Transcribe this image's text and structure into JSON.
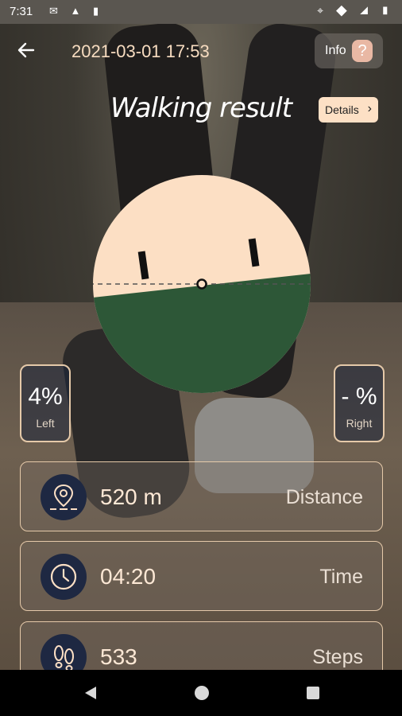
{
  "status_bar": {
    "time": "7:31",
    "left_icons": [
      "gmail-icon",
      "drive-icon",
      "sd-card-icon"
    ],
    "right_icons": [
      "location-icon",
      "wifi-icon",
      "signal-icon",
      "battery-icon"
    ]
  },
  "header": {
    "datetime": "2021-03-01 17:53",
    "info_label": "Info",
    "info_q": "?"
  },
  "title": "Walking result",
  "details_label": "Details",
  "balance": {
    "left_value": "4%",
    "left_label": "Left",
    "right_value": "- %",
    "right_label": "Right",
    "tilt_deg": -4,
    "colors": {
      "top": "#fcdfc4",
      "bottom": "#2d5737"
    }
  },
  "stats": [
    {
      "icon": "location-pin-icon",
      "value": "520 m",
      "label": "Distance"
    },
    {
      "icon": "clock-icon",
      "value": "04:20",
      "label": "Time"
    },
    {
      "icon": "footsteps-icon",
      "value": "533",
      "label": "Steps"
    }
  ]
}
